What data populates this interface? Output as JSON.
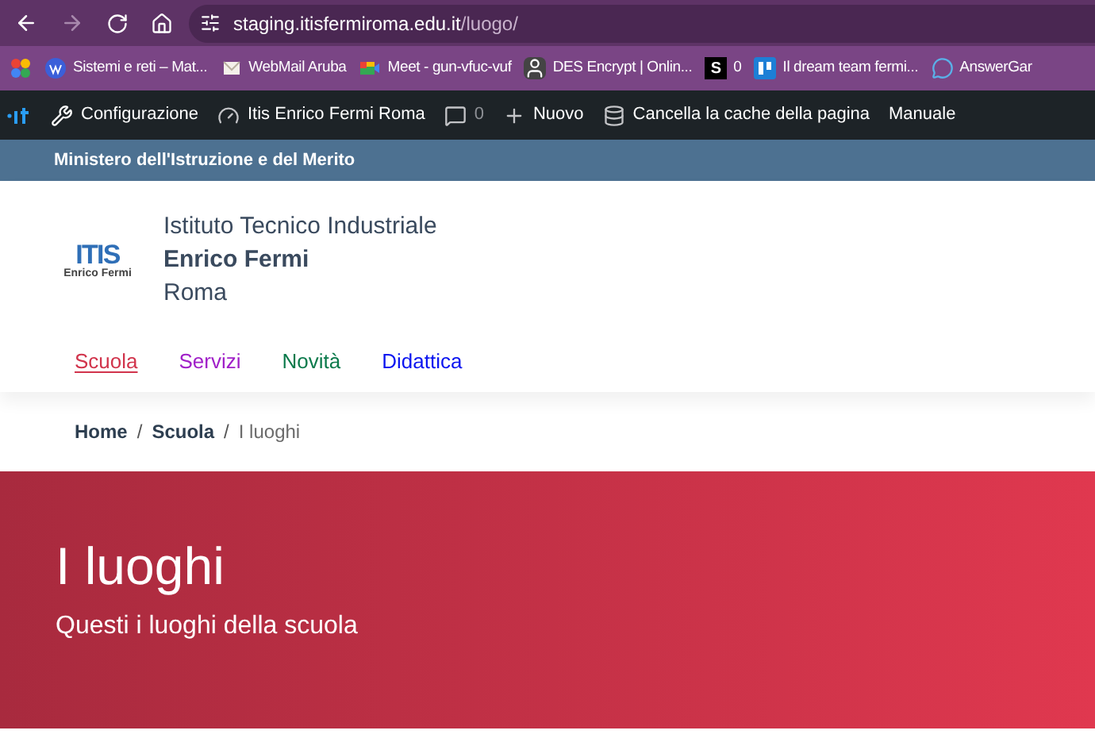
{
  "browser": {
    "url_host": "staging.itisfermiroma.edu.it",
    "url_path": "/luogo/"
  },
  "bookmarks": [
    {
      "kind": "photos"
    },
    {
      "kind": "wordpress",
      "label": "Sistemi e reti – Mat..."
    },
    {
      "kind": "mail",
      "label": "WebMail Aruba"
    },
    {
      "kind": "meet",
      "label": "Meet - gun-vfuc-vuf"
    },
    {
      "kind": "person",
      "label": "DES Encrypt | Onlin..."
    },
    {
      "kind": "letter",
      "letter": "S",
      "label": "0"
    },
    {
      "kind": "trello",
      "label": "Il dream team fermi..."
    },
    {
      "kind": "chat",
      "label": "AnswerGar"
    }
  ],
  "admin_bar": {
    "items": [
      {
        "kind": "wrench",
        "label": "Configurazione"
      },
      {
        "kind": "gauge",
        "label": "Itis Enrico Fermi Roma"
      },
      {
        "kind": "comment",
        "label": "0"
      },
      {
        "kind": "plus",
        "label": "Nuovo"
      },
      {
        "kind": "database",
        "label": "Cancella la cache della pagina"
      },
      {
        "kind": "none",
        "label": "Manuale"
      }
    ]
  },
  "ministry_bar": {
    "label": "Ministero dell'Istruzione e del Merito"
  },
  "header": {
    "logo": {
      "mark": "ITIS",
      "caption": "Enrico Fermi"
    },
    "line_1": "Istituto Tecnico Industriale",
    "line_2": "Enrico Fermi",
    "line_3": "Roma"
  },
  "nav": [
    {
      "label": "Scuola",
      "selected": true,
      "color": "#d1344c"
    },
    {
      "label": "Servizi",
      "selected": false,
      "color": "#a020c8"
    },
    {
      "label": "Novità",
      "selected": false,
      "color": "#0b7a4b"
    },
    {
      "label": "Didattica",
      "selected": false,
      "color": "#0a14f0"
    }
  ],
  "breadcrumb": [
    {
      "label": "Home",
      "current": false,
      "separator": "/"
    },
    {
      "label": "Scuola",
      "current": false,
      "separator": "/"
    },
    {
      "label": "I luoghi",
      "current": true
    }
  ],
  "hero": {
    "title": "I luoghi",
    "subtitle": "Questi i luoghi della scuola"
  }
}
